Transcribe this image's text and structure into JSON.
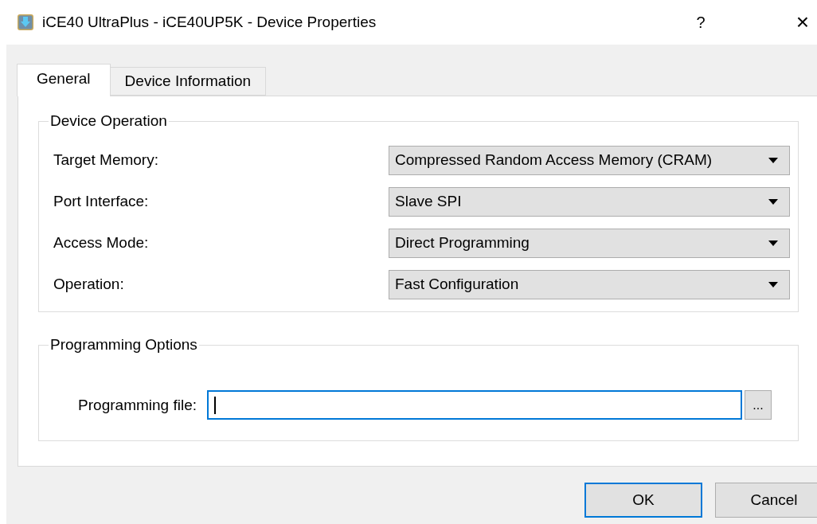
{
  "window": {
    "title": "iCE40 UltraPlus - iCE40UP5K - Device Properties",
    "help": "?",
    "close": "×"
  },
  "tabs": [
    {
      "label": "General",
      "selected": true
    },
    {
      "label": "Device Information",
      "selected": false
    }
  ],
  "device_operation": {
    "title": "Device Operation",
    "fields": [
      {
        "label": "Target Memory:",
        "value": "Compressed Random Access Memory (CRAM)"
      },
      {
        "label": "Port Interface:",
        "value": "Slave SPI"
      },
      {
        "label": "Access Mode:",
        "value": "Direct Programming"
      },
      {
        "label": "Operation:",
        "value": "Fast Configuration"
      }
    ]
  },
  "programming_options": {
    "title": "Programming Options",
    "file_label": "Programming file:",
    "file_focused": true,
    "browse": "..."
  },
  "buttons": [
    {
      "label": "OK",
      "default": true
    },
    {
      "label": "Cancel",
      "default": false
    }
  ]
}
